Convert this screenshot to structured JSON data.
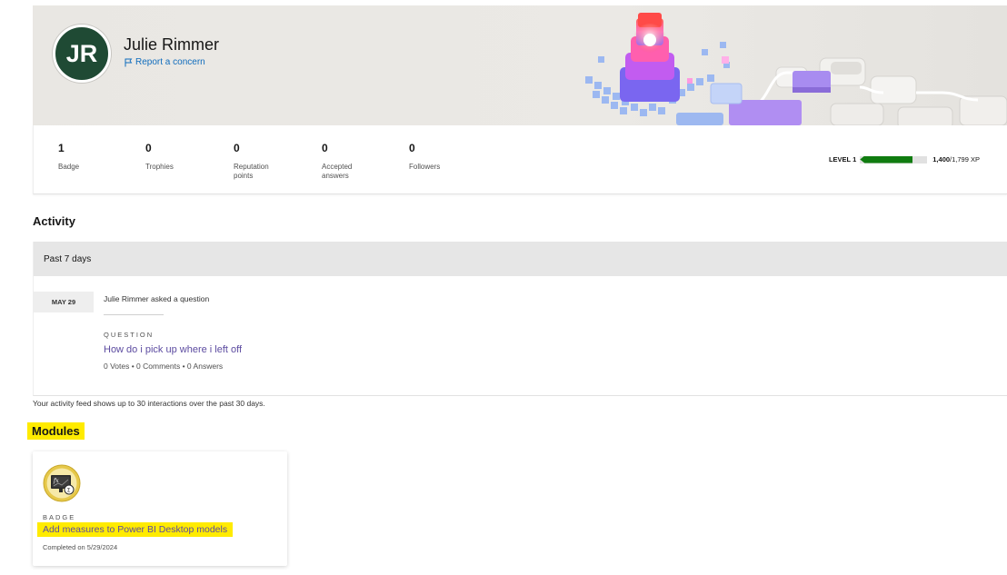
{
  "profile": {
    "initials": "JR",
    "name": "Julie Rimmer",
    "report_label": "Report a concern",
    "colors": {
      "avatar_bg": "#1f4a34",
      "link": "#0f6cbd"
    }
  },
  "stats": [
    {
      "value": "1",
      "label": "Badge"
    },
    {
      "value": "0",
      "label": "Trophies"
    },
    {
      "value": "0",
      "label": "Reputation points"
    },
    {
      "value": "0",
      "label": "Accepted answers"
    },
    {
      "value": "0",
      "label": "Followers"
    }
  ],
  "level": {
    "label": "LEVEL 1",
    "xp_current": "1,400",
    "xp_total": "/1,799 XP",
    "progress_fraction": 0.78,
    "bar_color": "#107c10"
  },
  "activity": {
    "title": "Activity",
    "period": "Past 7 days",
    "items": [
      {
        "date": "MAY 29",
        "actor_text": "Julie Rimmer asked a question",
        "eyebrow": "QUESTION",
        "title": "How do i pick up where i left off",
        "meta": "0 Votes • 0 Comments • 0 Answers"
      }
    ],
    "note": "Your activity feed shows up to 30 interactions over the past 30 days."
  },
  "modules": {
    "title": "Modules",
    "items": [
      {
        "badge_icon": "power-bi-measures-badge-icon",
        "eyebrow": "BADGE",
        "title": "Add measures to Power BI Desktop models",
        "completed": "Completed on 5/29/2024"
      }
    ]
  },
  "highlight_color": "#ffeb00"
}
